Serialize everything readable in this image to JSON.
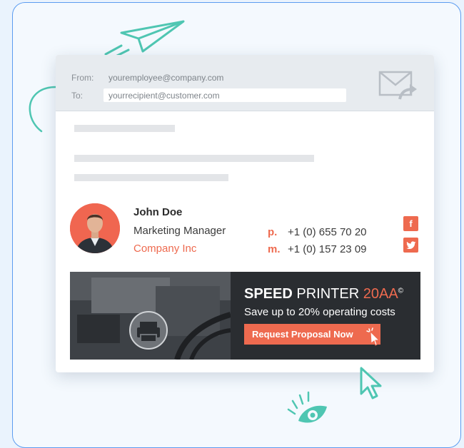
{
  "email": {
    "from_label": "From:",
    "from_value": "youremployee@company.com",
    "to_label": "To:",
    "to_value": "yourrecipient@customer.com"
  },
  "signature": {
    "name": "John Doe",
    "title": "Marketing Manager",
    "company": "Company Inc",
    "phones": [
      {
        "prefix": "p.",
        "number": "+1 (0) 655 70 20"
      },
      {
        "prefix": "m.",
        "number": "+1 (0) 157 23 09"
      }
    ],
    "social": [
      {
        "icon": "facebook-icon",
        "glyph": "f"
      },
      {
        "icon": "twitter-icon",
        "glyph": "🐦"
      }
    ]
  },
  "banner": {
    "headline_bold": "SPEED",
    "headline_regular": "PRINTER",
    "headline_accent": "20AA",
    "headline_mark": "©",
    "subtitle": "Save up to 20% operating costs",
    "cta_label": "Request Proposal Now"
  },
  "colors": {
    "accent": "#ee6a4f",
    "frame_border": "#5b9cf0",
    "decor_teal": "#4fc6b2",
    "banner_bg": "#2a2d31"
  },
  "icons": [
    "paper-plane-icon",
    "mail-forward-icon",
    "cursor-icon",
    "eye-icon",
    "printer-icon"
  ]
}
